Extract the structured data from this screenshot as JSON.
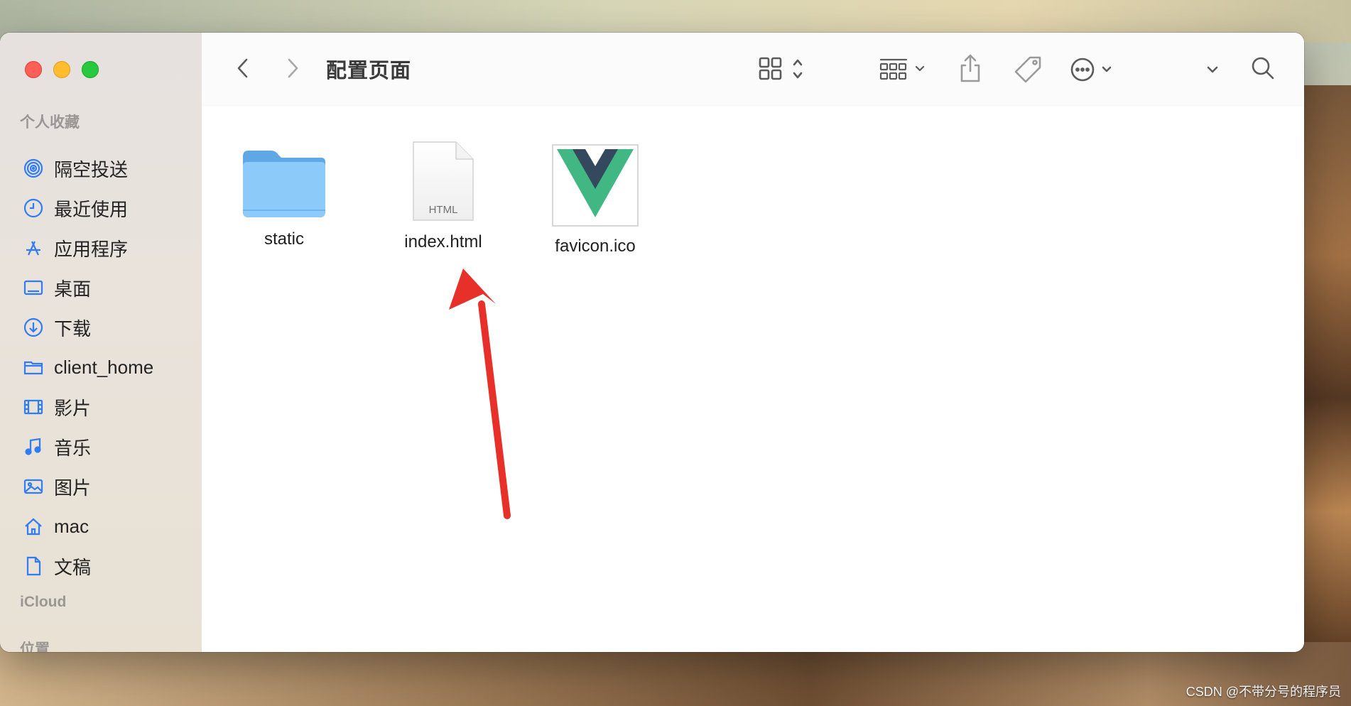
{
  "window": {
    "title": "配置页面"
  },
  "sidebar": {
    "favorites_title": "个人收藏",
    "items": [
      {
        "label": "隔空投送",
        "icon": "airdrop-icon"
      },
      {
        "label": "最近使用",
        "icon": "clock-icon"
      },
      {
        "label": "应用程序",
        "icon": "applications-icon"
      },
      {
        "label": "桌面",
        "icon": "desktop-icon"
      },
      {
        "label": "下载",
        "icon": "download-icon"
      },
      {
        "label": "client_home",
        "icon": "folder-icon"
      },
      {
        "label": "影片",
        "icon": "film-icon"
      },
      {
        "label": "音乐",
        "icon": "music-note-icon"
      },
      {
        "label": "图片",
        "icon": "photo-icon"
      },
      {
        "label": "mac",
        "icon": "home-icon"
      },
      {
        "label": "文稿",
        "icon": "document-icon"
      }
    ],
    "icloud_title": "iCloud",
    "locations_title": "位置"
  },
  "toolbar": {
    "buttons": [
      "back-icon",
      "forward-icon",
      "icon-view-icon",
      "group-icon",
      "share-icon",
      "tag-icon",
      "more-icon",
      "expand-icon",
      "search-icon"
    ]
  },
  "files": [
    {
      "name": "static",
      "type": "folder"
    },
    {
      "name": "index.html",
      "type": "html",
      "badge": "HTML"
    },
    {
      "name": "favicon.ico",
      "type": "image"
    }
  ],
  "annotation": {
    "type": "arrow",
    "color": "#e8302a",
    "points_to": "index.html"
  },
  "watermark": "CSDN @不带分号的程序员",
  "colors": {
    "accent": "#2f7cf6",
    "close": "#fe5f57",
    "minimize": "#febc2e",
    "maximize": "#28c840",
    "folder": "#8ccbf9",
    "vue_green": "#41b883",
    "vue_dark": "#34495e"
  }
}
